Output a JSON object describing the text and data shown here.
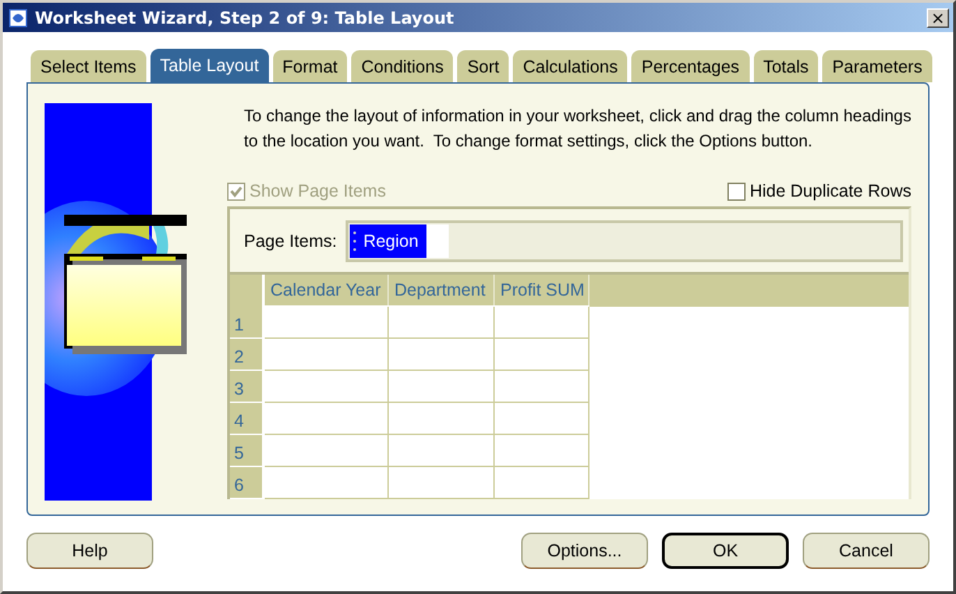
{
  "window": {
    "title": "Worksheet Wizard, Step 2 of 9: Table Layout",
    "close": "×"
  },
  "tabs": [
    {
      "label": "Select Items",
      "selected": false
    },
    {
      "label": "Table Layout",
      "selected": true
    },
    {
      "label": "Format",
      "selected": false
    },
    {
      "label": "Conditions",
      "selected": false
    },
    {
      "label": "Sort",
      "selected": false
    },
    {
      "label": "Calculations",
      "selected": false
    },
    {
      "label": "Percentages",
      "selected": false
    },
    {
      "label": "Totals",
      "selected": false
    },
    {
      "label": "Parameters",
      "selected": false
    }
  ],
  "instructions": "To change the layout of information in your worksheet, click and drag the column headings to the location you want.  To change format settings, click the Options button.",
  "options": [
    {
      "label": "Show Page Items",
      "checked": true,
      "disabled": true
    },
    {
      "label": "Hide Duplicate Rows",
      "checked": false,
      "disabled": false
    }
  ],
  "page_items": {
    "label": "Page Items:",
    "items": [
      {
        "label": "Region",
        "selected": true
      }
    ]
  },
  "table": {
    "columns": [
      "Calendar Year",
      "Department",
      "Profit SUM"
    ],
    "rows": [
      "1",
      "2",
      "3",
      "4",
      "5",
      "6"
    ]
  },
  "buttons": [
    {
      "label": "Help",
      "default": false
    },
    {
      "label": "Options...",
      "default": false
    },
    {
      "label": "OK",
      "default": true
    },
    {
      "label": "Cancel",
      "default": false
    }
  ]
}
